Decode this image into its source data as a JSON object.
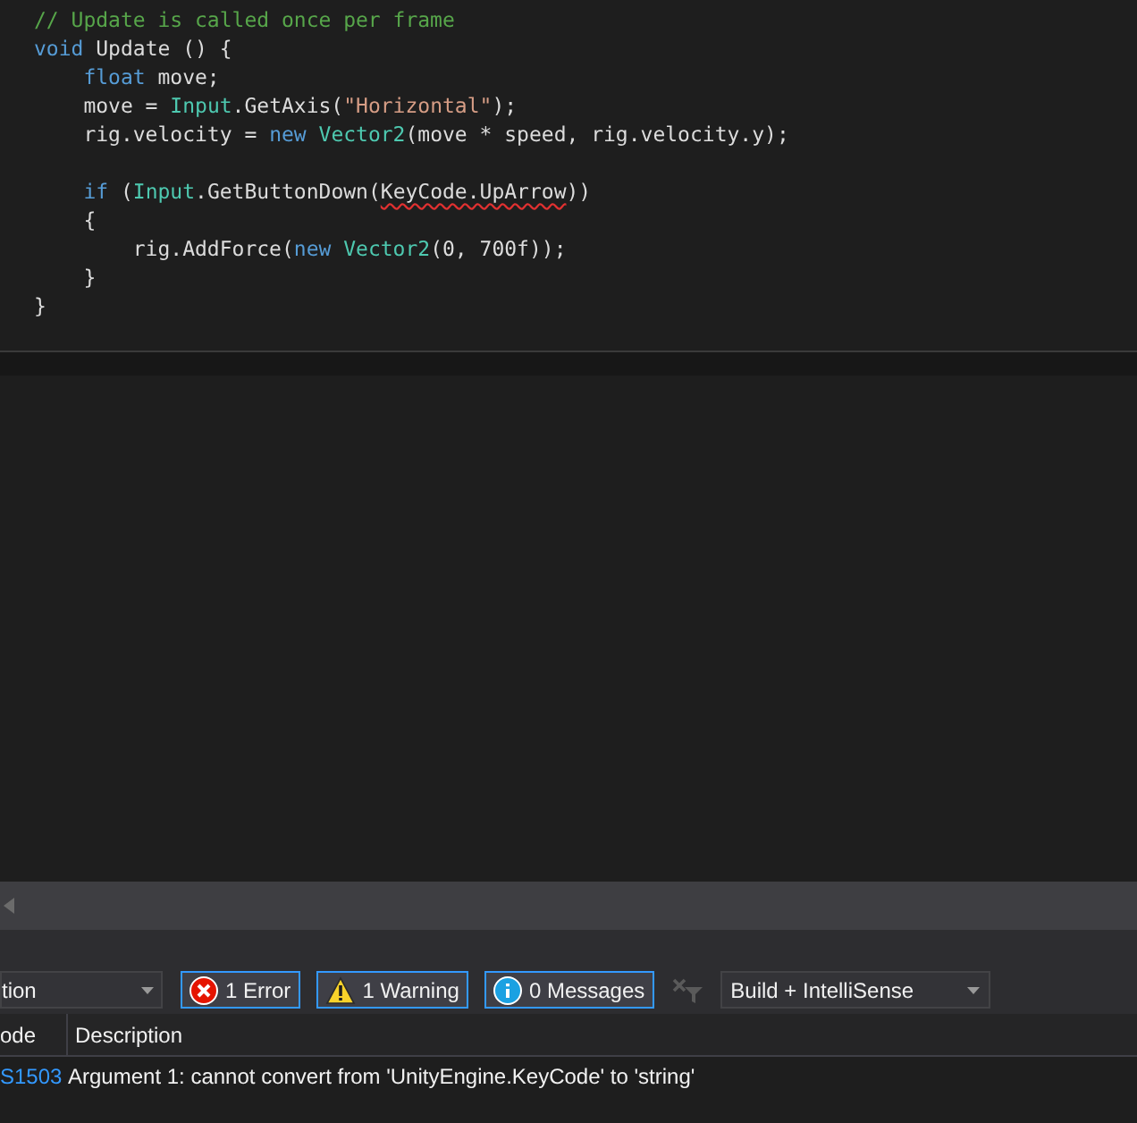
{
  "code_lines": [
    {
      "tokens": [
        {
          "text": "// Update is called once per frame",
          "kind": "comment"
        }
      ]
    },
    {
      "tokens": [
        {
          "text": "void",
          "kind": "keyword"
        },
        {
          "text": " Update () {",
          "kind": "plain"
        }
      ]
    },
    {
      "tokens": [
        {
          "text": "    float",
          "kind": "keyword"
        },
        {
          "text": " move;",
          "kind": "plain"
        }
      ]
    },
    {
      "tokens": [
        {
          "text": "    move = ",
          "kind": "plain"
        },
        {
          "text": "Input",
          "kind": "type"
        },
        {
          "text": ".GetAxis(",
          "kind": "plain"
        },
        {
          "text": "\"Horizontal\"",
          "kind": "string"
        },
        {
          "text": ");",
          "kind": "plain"
        }
      ]
    },
    {
      "tokens": [
        {
          "text": "    rig.velocity = ",
          "kind": "plain"
        },
        {
          "text": "new ",
          "kind": "keyword"
        },
        {
          "text": "Vector2",
          "kind": "type"
        },
        {
          "text": "(move * speed, rig.velocity.y);",
          "kind": "plain"
        }
      ]
    },
    {
      "blank_before": true,
      "tokens": [
        {
          "text": "    if",
          "kind": "keyword"
        },
        {
          "text": " (",
          "kind": "plain"
        },
        {
          "text": "Input",
          "kind": "type"
        },
        {
          "text": ".GetButtonDown(",
          "kind": "plain"
        },
        {
          "text": "KeyCode.UpArrow",
          "kind": "error"
        },
        {
          "text": "))",
          "kind": "plain"
        }
      ]
    },
    {
      "tokens": [
        {
          "text": "    {",
          "kind": "plain"
        }
      ]
    },
    {
      "tokens": [
        {
          "text": "        rig.AddForce(",
          "kind": "plain"
        },
        {
          "text": "new ",
          "kind": "keyword"
        },
        {
          "text": "Vector2",
          "kind": "type"
        },
        {
          "text": "(0, 700f));",
          "kind": "plain"
        }
      ]
    },
    {
      "tokens": [
        {
          "text": "    }",
          "kind": "plain"
        }
      ]
    },
    {
      "tokens": [
        {
          "text": "}",
          "kind": "plain"
        }
      ]
    }
  ],
  "error_list": {
    "scope_dropdown": "tion",
    "filters": [
      {
        "kind": "error",
        "label": "1 Error",
        "selected": true
      },
      {
        "kind": "warning",
        "label": "1 Warning",
        "selected": true
      },
      {
        "kind": "info",
        "label": "0 Messages",
        "selected": true
      }
    ],
    "source_dropdown": "Build + IntelliSense",
    "columns": [
      "ode",
      "Description"
    ],
    "rows": [
      {
        "code": "S1503",
        "description": "Argument 1: cannot convert from 'UnityEngine.KeyCode' to 'string'"
      }
    ]
  }
}
